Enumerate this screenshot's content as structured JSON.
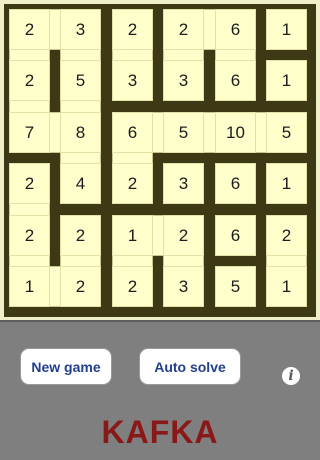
{
  "board": {
    "rows": [
      [
        "2",
        "3",
        "2",
        "2",
        "6",
        "1"
      ],
      [
        "2",
        "5",
        "3",
        "3",
        "6",
        "1"
      ],
      [
        "7",
        "8",
        "6",
        "5",
        "10",
        "5"
      ],
      [
        "2",
        "4",
        "2",
        "3",
        "6",
        "1"
      ],
      [
        "2",
        "2",
        "1",
        "2",
        "6",
        "2"
      ],
      [
        "1",
        "2",
        "2",
        "3",
        "5",
        "1"
      ]
    ],
    "h_links": [
      [
        0,
        0
      ],
      [
        0,
        3
      ],
      [
        2,
        0
      ],
      [
        2,
        2
      ],
      [
        2,
        3
      ],
      [
        2,
        4
      ],
      [
        4,
        2
      ],
      [
        5,
        0
      ]
    ],
    "v_links": [
      [
        0,
        0
      ],
      [
        0,
        1
      ],
      [
        0,
        2
      ],
      [
        0,
        3
      ],
      [
        0,
        4
      ],
      [
        1,
        0
      ],
      [
        1,
        1
      ],
      [
        2,
        1
      ],
      [
        2,
        2
      ],
      [
        3,
        0
      ],
      [
        4,
        0
      ],
      [
        4,
        1
      ],
      [
        4,
        2
      ],
      [
        4,
        3
      ],
      [
        4,
        5
      ]
    ]
  },
  "controls": {
    "new_game_label": "New game",
    "auto_solve_label": "Auto solve",
    "info_label": "i"
  },
  "app": {
    "title": "KAFKA"
  }
}
